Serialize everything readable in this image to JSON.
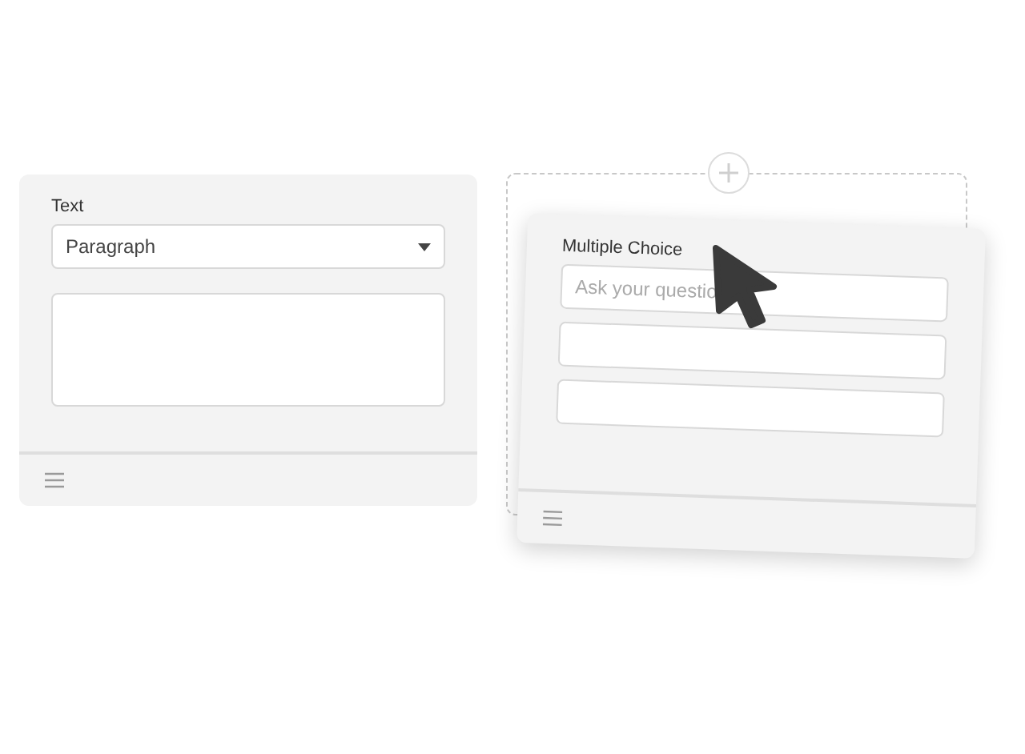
{
  "text_card": {
    "title": "Text",
    "select": {
      "value": "Paragraph"
    }
  },
  "choice_card": {
    "title": "Multiple Choice",
    "question": {
      "placeholder": "Ask your questio"
    }
  }
}
